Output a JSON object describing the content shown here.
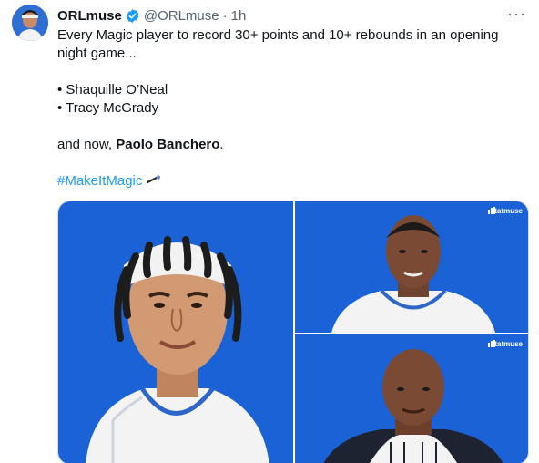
{
  "tweet": {
    "display_name": "ORLmuse",
    "handle": "@ORLmuse",
    "separator": "·",
    "time": "1h",
    "more": "···",
    "lines": {
      "l1": "Every Magic player to record 30+ points and 10+ rebounds in an opening",
      "l2": "night game...",
      "bullet1": "• Shaquille O’Neal",
      "bullet2": "• Tracy McGrady",
      "and_now": "and now, ",
      "player": "Paolo Banchero",
      "period": ".",
      "hashtag": "#MakeItMagic"
    }
  },
  "media": {
    "watermark": "statmuse"
  },
  "colors": {
    "accent": "#1d9bf0",
    "panel_blue": "#1b62d6",
    "muted": "#536471"
  },
  "icons": [
    "verified-badge-icon",
    "more-options-icon",
    "magic-wand-emoji-icon",
    "statmuse-logo-icon"
  ]
}
